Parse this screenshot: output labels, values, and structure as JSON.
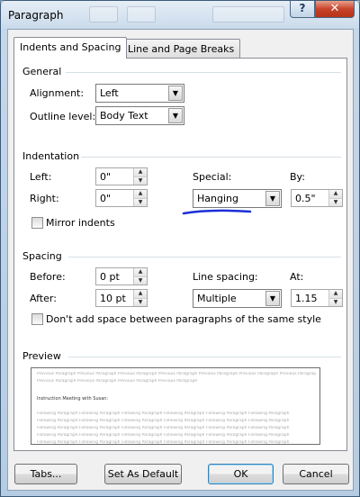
{
  "window": {
    "title": "Paragraph",
    "help_glyph": "?",
    "close_glyph": "✕"
  },
  "tabs": [
    {
      "label": "Indents and Spacing",
      "active": true
    },
    {
      "label": "Line and Page Breaks",
      "active": false
    }
  ],
  "general": {
    "heading": "General",
    "alignment_label": "Alignment:",
    "alignment_value": "Left",
    "outline_label": "Outline level:",
    "outline_value": "Body Text"
  },
  "indentation": {
    "heading": "Indentation",
    "left_label": "Left:",
    "left_value": "0\"",
    "right_label": "Right:",
    "right_value": "0\"",
    "special_label": "Special:",
    "special_value": "Hanging",
    "by_label": "By:",
    "by_value": "0.5\"",
    "mirror_label": "Mirror indents",
    "mirror_checked": false
  },
  "spacing": {
    "heading": "Spacing",
    "before_label": "Before:",
    "before_value": "0 pt",
    "after_label": "After:",
    "after_value": "10 pt",
    "line_spacing_label": "Line spacing:",
    "line_spacing_value": "Multiple",
    "at_label": "At:",
    "at_value": "1.15",
    "dont_add_label": "Don't add space between paragraphs of the same style",
    "dont_add_checked": false
  },
  "preview": {
    "heading": "Preview",
    "previous_lines": [
      "Previous Paragraph Previous Paragraph Previous Paragraph Previous Paragraph Previous Paragraph Previous Paragraph Previous Paragraph",
      "Previous Paragraph Previous Paragraph Previous Paragraph Previous Paragraph"
    ],
    "sample_text": "Instruction Meeting with Susan:",
    "following_lines": [
      "Following Paragraph Following Paragraph Following Paragraph Following Paragraph Following Paragraph Following Paragraph",
      "Following Paragraph Following Paragraph Following Paragraph Following Paragraph Following Paragraph Following Paragraph",
      "Following Paragraph Following Paragraph Following Paragraph Following Paragraph Following Paragraph Following Paragraph",
      "Following Paragraph Following Paragraph Following Paragraph Following Paragraph Following Paragraph Following Paragraph",
      "Following Paragraph Following Paragraph Following Paragraph Following Paragraph Following Paragraph Following Paragraph"
    ]
  },
  "buttons": {
    "tabs": "Tabs...",
    "set_default": "Set As Default",
    "ok": "OK",
    "cancel": "Cancel"
  },
  "colors": {
    "annotation_ink": "#1c2fd6",
    "titlebar": "#b8cde2",
    "close": "#c7442b"
  }
}
